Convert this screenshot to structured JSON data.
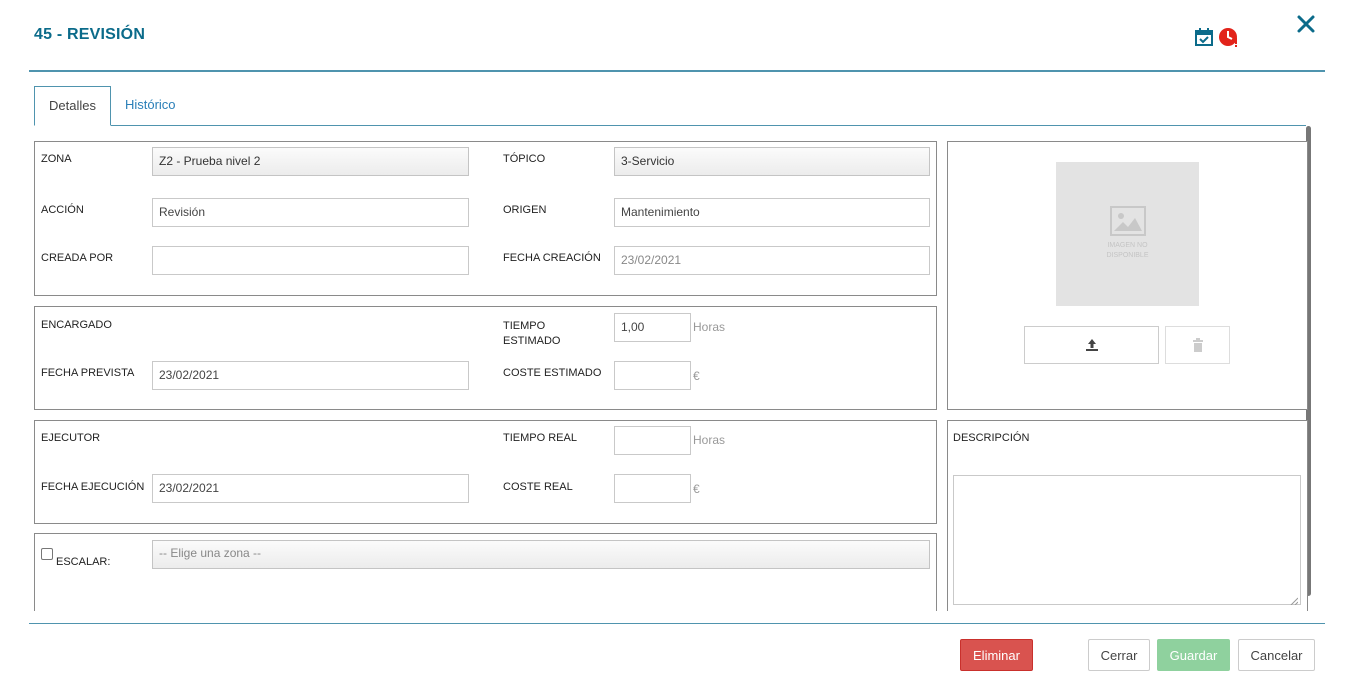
{
  "header": {
    "title": "45 - REVISIÓN",
    "accent_color": "#0b6b8a",
    "icons": [
      "calendar-check-icon",
      "clock-alert-icon",
      "close-icon"
    ]
  },
  "tabs": [
    {
      "label": "Detalles",
      "active": true
    },
    {
      "label": "Histórico",
      "active": false
    }
  ],
  "general": {
    "zona_label": "ZONA",
    "zona_value": "Z2 - Prueba nivel 2",
    "topico_label": "TÓPICO",
    "topico_value": "3-Servicio",
    "accion_label": "ACCIÓN",
    "accion_value": "Revisión",
    "origen_label": "ORIGEN",
    "origen_value": "Mantenimiento",
    "creada_por_label": "CREADA POR",
    "creada_por_value": "",
    "fecha_creacion_label": "FECHA CREACIÓN",
    "fecha_creacion_value": "23/02/2021"
  },
  "planning": {
    "encargado_label": "ENCARGADO",
    "tiempo_estimado_label_1": "TIEMPO",
    "tiempo_estimado_label_2": "ESTIMADO",
    "tiempo_estimado_value": "1,00",
    "tiempo_estimado_unit": "Horas",
    "fecha_prevista_label": "FECHA PREVISTA",
    "fecha_prevista_value": "23/02/2021",
    "coste_estimado_label": "COSTE ESTIMADO",
    "coste_estimado_value": "",
    "coste_estimado_unit": "€"
  },
  "execution": {
    "ejecutor_label": "EJECUTOR",
    "tiempo_real_label": "TIEMPO REAL",
    "tiempo_real_value": "",
    "tiempo_real_unit": "Horas",
    "fecha_ejecucion_label": "FECHA EJECUCIÓN",
    "fecha_ejecucion_value": "23/02/2021",
    "coste_real_label": "COSTE REAL",
    "coste_real_value": "",
    "coste_real_unit": "€"
  },
  "escalar": {
    "label": "ESCALAR:",
    "checked": false,
    "select_value": "-- Elige una zona --"
  },
  "image": {
    "placeholder_line1": "IMAGEN NO",
    "placeholder_line2": "DISPONIBLE"
  },
  "descripcion": {
    "label": "DESCRIPCIÓN",
    "value": ""
  },
  "footer": {
    "eliminar": "Eliminar",
    "cerrar": "Cerrar",
    "guardar": "Guardar",
    "cancelar": "Cancelar",
    "danger_color": "#d9534f",
    "success_color": "#8fd19e"
  }
}
